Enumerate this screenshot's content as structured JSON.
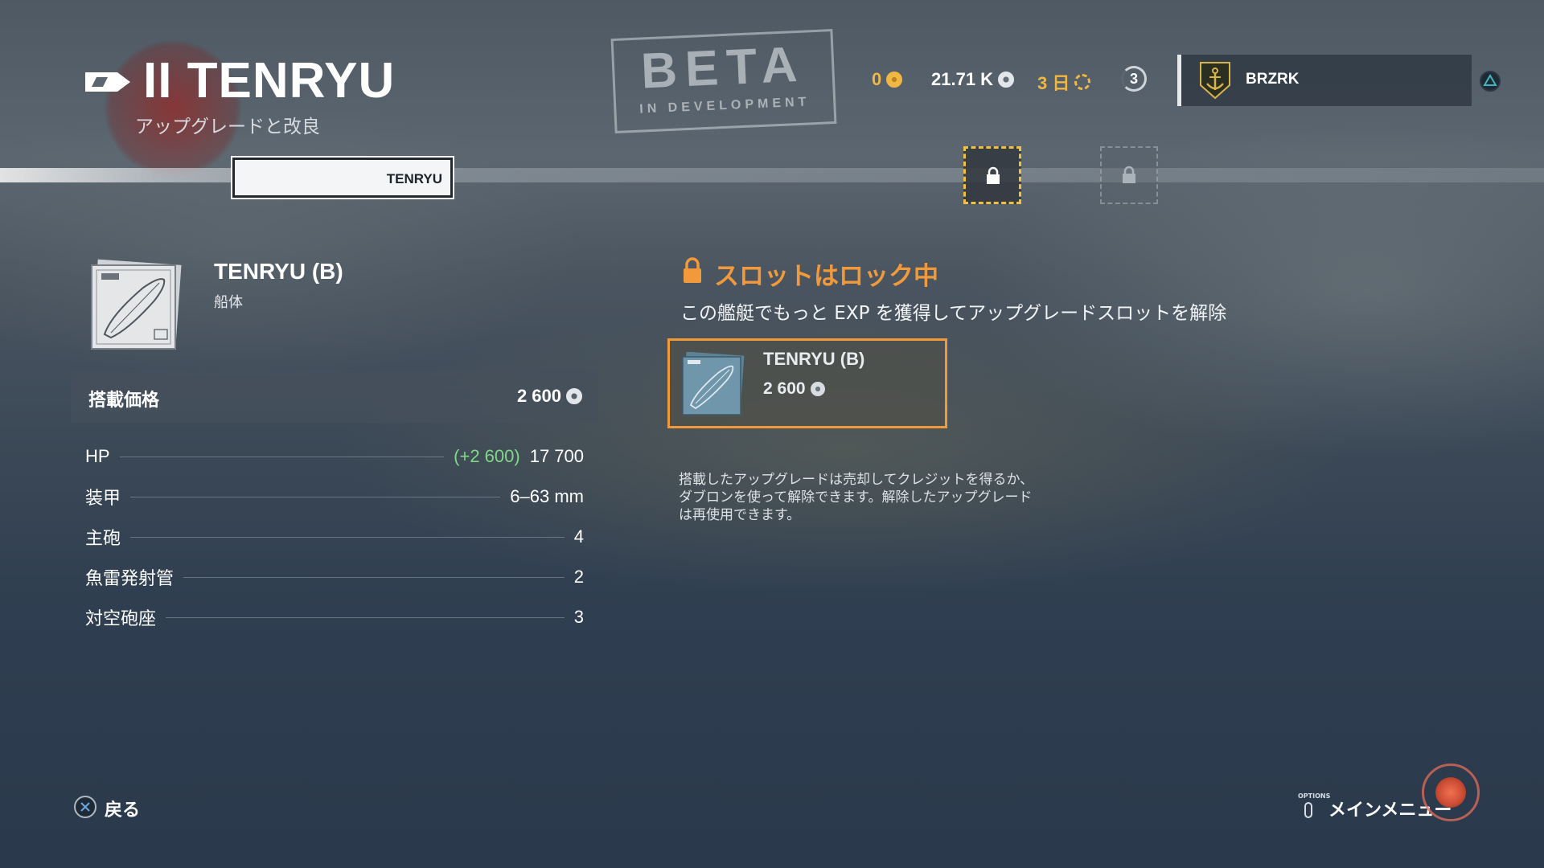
{
  "header": {
    "title": "II TENRYU",
    "subtitle": "アップグレードと改良",
    "beta": "BETA",
    "beta_sub": "IN DEVELOPMENT"
  },
  "currencies": {
    "gold": "0",
    "credits": "21.71 K",
    "premium": "3 日",
    "level": "3"
  },
  "profile": {
    "name": "BRZRK"
  },
  "slots": {
    "active_label": "TENRYU"
  },
  "module": {
    "name": "TENRYU (B)",
    "type": "船体",
    "price_label": "搭載価格",
    "price": "2 600"
  },
  "stats": [
    {
      "label": "HP",
      "bonus": "(+2 600)",
      "value": "17 700"
    },
    {
      "label": "装甲",
      "bonus": "",
      "value": "6–63 mm"
    },
    {
      "label": "主砲",
      "bonus": "",
      "value": "4"
    },
    {
      "label": "魚雷発射管",
      "bonus": "",
      "value": "2"
    },
    {
      "label": "対空砲座",
      "bonus": "",
      "value": "3"
    }
  ],
  "lock": {
    "title": "スロットはロック中",
    "description": "この艦艇でもっと EXP を獲得してアップグレードスロットを解除",
    "card_name": "TENRYU (B)",
    "card_price": "2 600",
    "info": "搭載したアップグレードは売却してクレジットを得るか、\nダブロンを使って解除できます。解除したアップグレード\nは再使用できます。"
  },
  "footer": {
    "back": "戻る",
    "options": "OPTIONS",
    "menu": "メインメニュー"
  },
  "colors": {
    "accent_orange": "#f29a3b",
    "gold": "#f0b743",
    "bonus_green": "#7fd889"
  }
}
